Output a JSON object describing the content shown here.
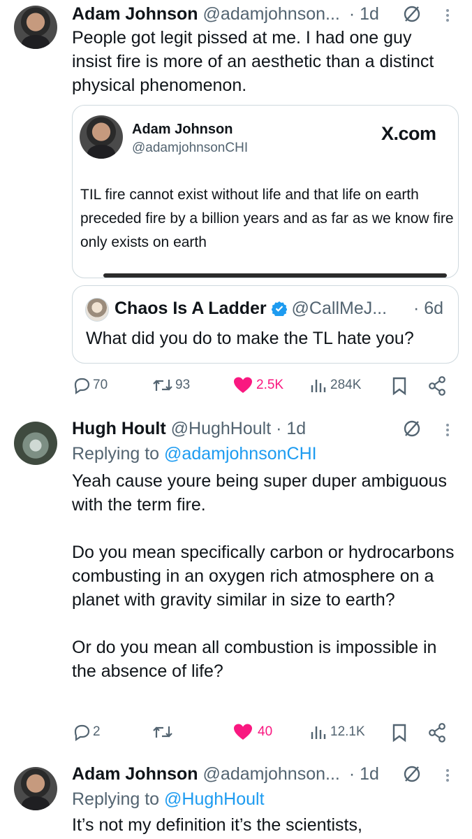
{
  "tweets": [
    {
      "name": "Adam Johnson",
      "handle": "@adamjohnson...",
      "time": "· 1d",
      "text": "People got legit pissed at me. I had one guy insist fire is more of an aesthetic than a distinct physical phenomenon.",
      "embed_card": {
        "name": "Adam Johnson",
        "handle": "@adamjohnsonCHI",
        "site": "X.com",
        "text": "TIL fire cannot exist without life and that life on earth preceded fire by a billion years and as far as we know fire only exists on earth"
      },
      "quote": {
        "name": "Chaos Is A Ladder",
        "handle": "@CallMeJ...",
        "time": "· 6d",
        "text": "What did you do to make the TL hate you?"
      },
      "actions": {
        "replies": "70",
        "reposts": "93",
        "likes": "2.5K",
        "views": "284K"
      }
    },
    {
      "name": "Hugh Hoult",
      "handle": "@HughHoult · 1d",
      "replying_prefix": "Replying to ",
      "replying_to": "@adamjohnsonCHI",
      "text": "Yeah cause youre being super duper ambiguous with the term fire.\n\nDo you mean specifically carbon or hydrocarbons combusting in an oxygen rich atmosphere on a planet with gravity similar in size to earth?\n\nOr do you mean all combustion is impossible in the absence of life?",
      "actions": {
        "replies": "2",
        "reposts": "",
        "likes": "40",
        "views": "12.1K"
      }
    },
    {
      "name": "Adam Johnson",
      "handle": "@adamjohnson...",
      "time": "· 1d",
      "replying_prefix": "Replying to ",
      "replying_to": "@HughHoult",
      "text": "It’s not my definition it’s the scientists,"
    }
  ],
  "colors": {
    "like": "#f91880",
    "link": "#1d9bf0",
    "muted": "#536471",
    "verified": "#1d9bf0"
  },
  "icons": [
    "grok-slash-icon",
    "more-vertical-icon",
    "reply-icon",
    "repost-icon",
    "heart-icon",
    "views-icon",
    "bookmark-icon",
    "share-icon",
    "verified-badge-icon",
    "x-logo"
  ]
}
